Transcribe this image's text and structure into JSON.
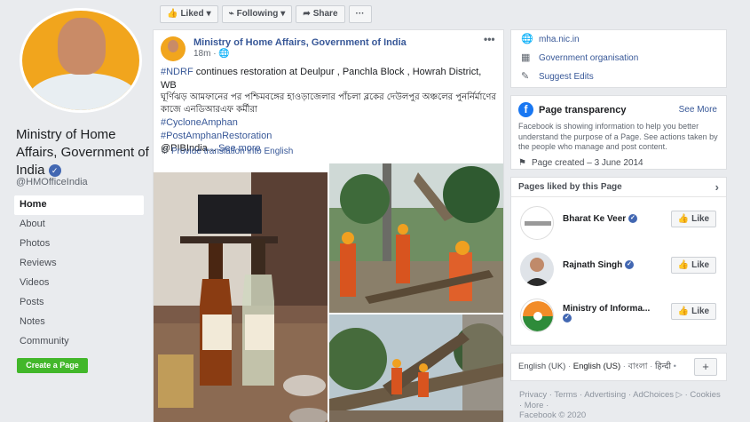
{
  "left": {
    "page_name": "Ministry of Home Affairs, Government of India",
    "handle": "@HMOfficeIndia",
    "nav": [
      "Home",
      "About",
      "Photos",
      "Reviews",
      "Videos",
      "Posts",
      "Notes",
      "Community"
    ],
    "create_page": "Create a Page"
  },
  "actionbar": {
    "liked": "Liked",
    "following": "Following",
    "share": "Share",
    "more": "···"
  },
  "post": {
    "author": "Ministry of Home Affairs, Government of India",
    "time": "18m",
    "more": "•••",
    "hashtag1": "#NDRF",
    "line1": " continues restoration at Deulpur , Panchla Block , Howrah District, WB",
    "bengali": "ঘূর্ণিঝড় আমফানের পর পশ্চিমবঙ্গের হাওড়াজেলার পাঁচলা ব্লকের দেউলপুর অঞ্চলের পুনর্নির্মাণের কাজে এনডিআরএফ কর্মীরা",
    "hashtag2": "#CycloneAmphan",
    "hashtag3": "#PostAmphanRestoration",
    "mention": "@PIBIndia...",
    "see_more": "See more",
    "translate": "Provide translation into English"
  },
  "about": {
    "website": "mha.nic.in",
    "category": "Government organisation",
    "suggest": "Suggest Edits"
  },
  "transparency": {
    "title": "Page transparency",
    "see_more": "See More",
    "desc": "Facebook is showing information to help you better understand the purpose of a Page. See actions taken by the people who manage and post content.",
    "created": "Page created – 3 June 2014"
  },
  "liked_pages": {
    "title": "Pages liked by this Page",
    "items": [
      {
        "name": "Bharat Ke Veer",
        "like": "Like"
      },
      {
        "name": "Rajnath Singh",
        "like": "Like"
      },
      {
        "name": "Ministry of Informa...",
        "like": "Like"
      }
    ]
  },
  "languages": {
    "l1": "English (UK)",
    "l2": "English (US)",
    "l3": "বাংলা",
    "l4": "हिन्दी",
    "more": "•",
    "plus": "+"
  },
  "footer": {
    "line1": "Privacy · Terms · Advertising · AdChoices ▷ · Cookies · More ·",
    "line2": "Facebook © 2020"
  },
  "colors": {
    "fb_blue": "#4267b2",
    "link": "#385898",
    "green": "#42b72a",
    "bg": "#e9ebee"
  }
}
